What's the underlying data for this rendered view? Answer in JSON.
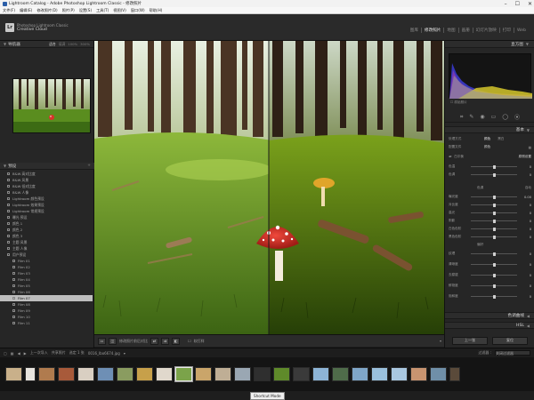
{
  "window": {
    "title": "Lightroom Catalog - Adobe Photoshop Lightroom Classic - 修改照片",
    "controls": [
      "–",
      "☐",
      "✕"
    ]
  },
  "menu": [
    "文件(F)",
    "编辑(E)",
    "修改照片(D)",
    "照片(P)",
    "设置(S)",
    "工具(T)",
    "视图(V)",
    "窗口(W)",
    "帮助(H)"
  ],
  "identity": {
    "line1": "Photoshop Lightroom Classic",
    "line2": "Creative Cloud",
    "logo": "Lr"
  },
  "modules": [
    {
      "label": "图库",
      "active": false
    },
    {
      "label": "修改照片",
      "active": true
    },
    {
      "label": "地图",
      "active": false
    },
    {
      "label": "画册",
      "active": false
    },
    {
      "label": "幻灯片放映",
      "active": false
    },
    {
      "label": "打印",
      "active": false
    },
    {
      "label": "Web",
      "active": false
    }
  ],
  "left": {
    "navigator": {
      "title": "导航器",
      "modes": [
        "适合",
        "填满",
        "100%",
        "300%"
      ],
      "active_mode": "适合"
    },
    "presets": {
      "title": "预设",
      "items": [
        {
          "label": "B&W 高对比度",
          "selected": false,
          "sub": false
        },
        {
          "label": "B&W 风景",
          "selected": false,
          "sub": false
        },
        {
          "label": "B&W 低对比度",
          "selected": false,
          "sub": false
        },
        {
          "label": "B&W 人像",
          "selected": false,
          "sub": false
        },
        {
          "label": "Lightroom 颜色预设",
          "selected": false,
          "sub": false
        },
        {
          "label": "Lightroom 效果预设",
          "selected": false,
          "sub": false
        },
        {
          "label": "Lightroom 常规预设",
          "selected": false,
          "sub": false
        },
        {
          "label": "曝光 预设",
          "selected": false,
          "sub": false
        },
        {
          "label": "颜色 1",
          "selected": false,
          "sub": false
        },
        {
          "label": "颜色 2",
          "selected": false,
          "sub": false
        },
        {
          "label": "颜色 3",
          "selected": false,
          "sub": false
        },
        {
          "label": "主题 风景",
          "selected": false,
          "sub": false
        },
        {
          "label": "主题 人像",
          "selected": false,
          "sub": false
        },
        {
          "label": "用户预设",
          "selected": false,
          "sub": false
        },
        {
          "label": "Film 01",
          "selected": false,
          "sub": true
        },
        {
          "label": "Film 02",
          "selected": false,
          "sub": true
        },
        {
          "label": "Film 03",
          "selected": false,
          "sub": true
        },
        {
          "label": "Film 04",
          "selected": false,
          "sub": true
        },
        {
          "label": "Film 05",
          "selected": false,
          "sub": true
        },
        {
          "label": "Film 06",
          "selected": false,
          "sub": true
        },
        {
          "label": "Film 07",
          "selected": true,
          "sub": true
        },
        {
          "label": "Film 08",
          "selected": false,
          "sub": true
        },
        {
          "label": "Film 09",
          "selected": false,
          "sub": true
        },
        {
          "label": "Film 10",
          "selected": false,
          "sub": true
        },
        {
          "label": "Film 11",
          "selected": false,
          "sub": true
        }
      ]
    },
    "buttons": {
      "copy": "复制...",
      "paste": "粘贴"
    }
  },
  "toolbar": {
    "label": "修改照片前后对比",
    "soft_proof": "软打样"
  },
  "right": {
    "histogram_title": "直方图",
    "original_photo": "原始照片",
    "basic": {
      "title": "基本",
      "treatment_label": "处理方式",
      "treatment_color": "颜色",
      "treatment_bw": "黑白",
      "profile_label": "配置文件",
      "profile_value": "颜色",
      "wb_label": "白平衡",
      "wb_value": "原照设置",
      "rows": [
        {
          "label": "色温",
          "value": "0",
          "pos": 0.5
        },
        {
          "label": "色调",
          "value": "0",
          "pos": 0.5
        }
      ],
      "tone_label": "色调",
      "tone_auto": "自动",
      "tone_rows": [
        {
          "label": "曝光度",
          "value": "0.00",
          "pos": 0.5
        },
        {
          "label": "对比度",
          "value": "0",
          "pos": 0.5
        },
        {
          "label": "高光",
          "value": "0",
          "pos": 0.5
        },
        {
          "label": "阴影",
          "value": "0",
          "pos": 0.5
        },
        {
          "label": "白色色阶",
          "value": "0",
          "pos": 0.5
        },
        {
          "label": "黑色色阶",
          "value": "0",
          "pos": 0.5
        }
      ],
      "presence_label": "偏好",
      "presence_rows": [
        {
          "label": "纹理",
          "value": "0",
          "pos": 0.5
        },
        {
          "label": "清晰度",
          "value": "0",
          "pos": 0.5
        },
        {
          "label": "去朦胧",
          "value": "0",
          "pos": 0.5
        },
        {
          "label": "鲜艳度",
          "value": "0",
          "pos": 0.5
        },
        {
          "label": "饱和度",
          "value": "0",
          "pos": 0.5
        }
      ]
    },
    "tone_curve": "色调曲线",
    "hsl": "HSL",
    "buttons": {
      "previous": "上一张",
      "reset": "复位"
    }
  },
  "filmstrip": {
    "left_text": "上一次导入",
    "count_text": "共享照片",
    "selected_text": "选定 1 张",
    "filename": "0016_Ibo6674.jpg",
    "filter_label": "过滤器 :",
    "filter_value": "关闭过滤器",
    "thumbnail_count": 30,
    "active_index": 14,
    "tooltip": "Shortcut Mode"
  },
  "colors": {
    "accent_active": "#f0f0f0",
    "panel_bg": "#262626",
    "selected_bg": "#bdbdbd"
  }
}
